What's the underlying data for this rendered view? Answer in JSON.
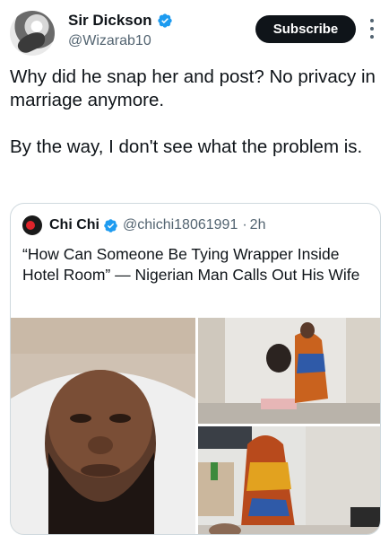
{
  "author": {
    "display_name": "Sir Dickson",
    "handle": "@Wizarab10",
    "subscribe_label": "Subscribe"
  },
  "tweet": {
    "text": "Why did he snap her and post? No privacy in marriage anymore.\n\nBy the way, I don't see what the problem is."
  },
  "quote": {
    "display_name": "Chi Chi",
    "handle": "@chichi18061991",
    "separator": "·",
    "time": "2h",
    "text": "“How Can Someone Be Tying Wrapper Inside Hotel Room” — Nigerian Man Calls Out His Wife"
  },
  "colors": {
    "verified": "#1d9bf0",
    "subscribe_bg": "#0f1419",
    "muted_text": "#536471",
    "border": "#cfd9de"
  },
  "icons": {
    "verified": "verified-badge-icon",
    "more": "more-options-icon"
  }
}
